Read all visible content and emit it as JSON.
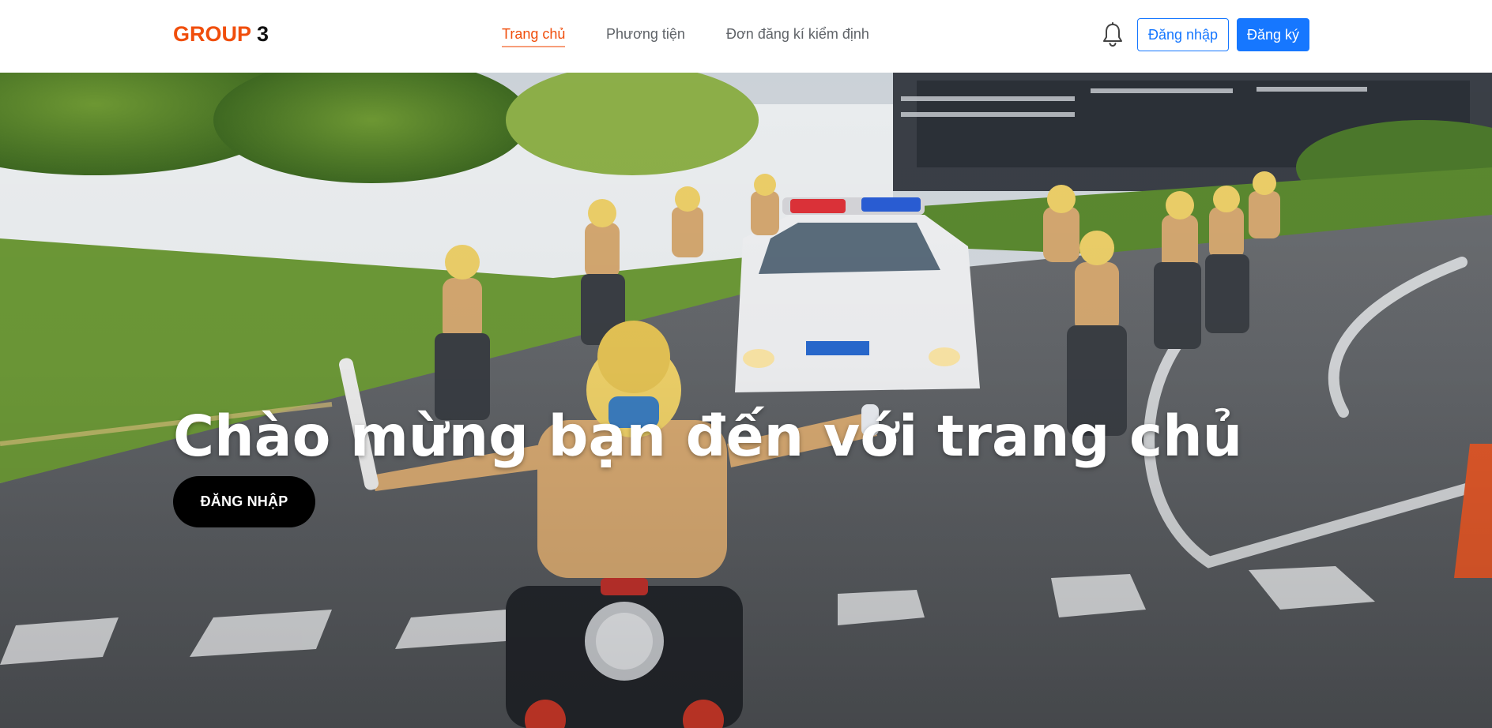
{
  "header": {
    "logo": {
      "accent": "GROUP",
      "rest": " 3"
    },
    "nav": [
      {
        "label": "Trang chủ",
        "active": true
      },
      {
        "label": "Phương tiện",
        "active": false
      },
      {
        "label": "Đơn đăng kí kiểm định",
        "active": false
      }
    ],
    "notification_icon": "bell-icon",
    "login_label": "Đăng nhập",
    "signup_label": "Đăng ký"
  },
  "hero": {
    "title": "Chào mừng bạn đến với trang chủ",
    "cta_label": "ĐĂNG NHẬP",
    "background": "photo of traffic police motorcycle escort on a city road"
  },
  "colors": {
    "accent": "#f04e0c",
    "primary": "#1677ff",
    "cta": "#000000"
  }
}
